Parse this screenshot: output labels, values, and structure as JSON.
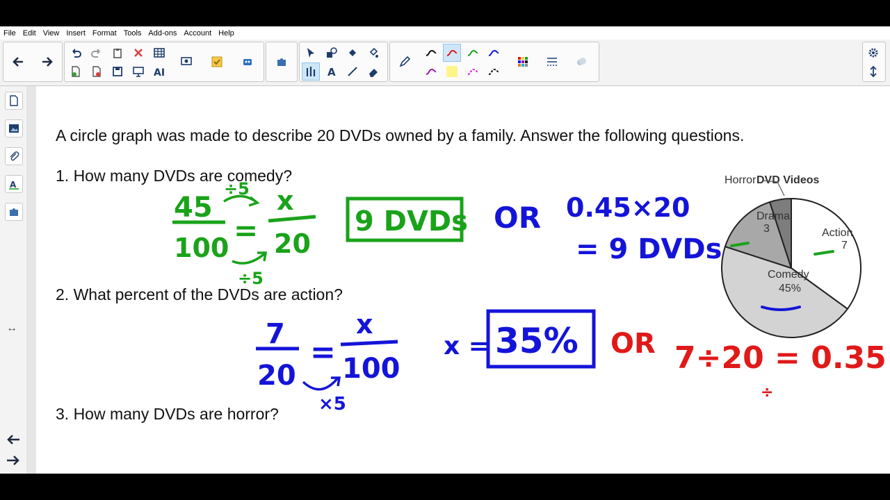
{
  "menu": [
    "File",
    "Edit",
    "View",
    "Insert",
    "Format",
    "Tools",
    "Add-ons",
    "Account",
    "Help"
  ],
  "toolbar": {
    "nav": [
      "back-arrow-icon",
      "forward-arrow-icon"
    ],
    "colors": {
      "accent": "#1a73e8",
      "green": "#1aa31a",
      "blue": "#1414d9",
      "red": "#e01919",
      "selected": "#cfe6f7"
    }
  },
  "canvas": {
    "intro": "A circle graph was made to describe 20 DVDs owned by a family. Answer the following questions.",
    "q1": "1. How many DVDs are comedy?",
    "q2": "2. What percent of the DVDs are action?",
    "q3": "3. How many DVDs are horror?"
  },
  "handwriting": {
    "q1": {
      "num1": "45",
      "den1": "100",
      "num2": "x",
      "den2": "20",
      "op_top": "÷5",
      "op_bottom": "÷5",
      "eq": "=",
      "answer": "9 DVDs",
      "or": "OR",
      "alt_line1": "0.45×20",
      "alt_line2": "= 9 DVDs"
    },
    "q2": {
      "num1": "7",
      "den1": "20",
      "num2": "x",
      "den2": "100",
      "op": "×5",
      "eq": "=",
      "x_eq": "x =",
      "answer": "35%",
      "or": "OR",
      "alt": "7÷20 = 0.35",
      "div": "÷"
    }
  },
  "chart_data": {
    "type": "pie",
    "title": "DVD Videos",
    "slices": [
      {
        "label": "Action",
        "value": 7,
        "value_label": "7",
        "color": "#ffffff"
      },
      {
        "label": "Comedy",
        "value": 9,
        "value_label": "45%",
        "color": "#d3d3d3"
      },
      {
        "label": "Drama",
        "value": 3,
        "value_label": "3",
        "color": "#a8a8a8"
      },
      {
        "label": "Horror",
        "value": 1,
        "value_label": "",
        "color": "#7d7d7d"
      }
    ]
  }
}
